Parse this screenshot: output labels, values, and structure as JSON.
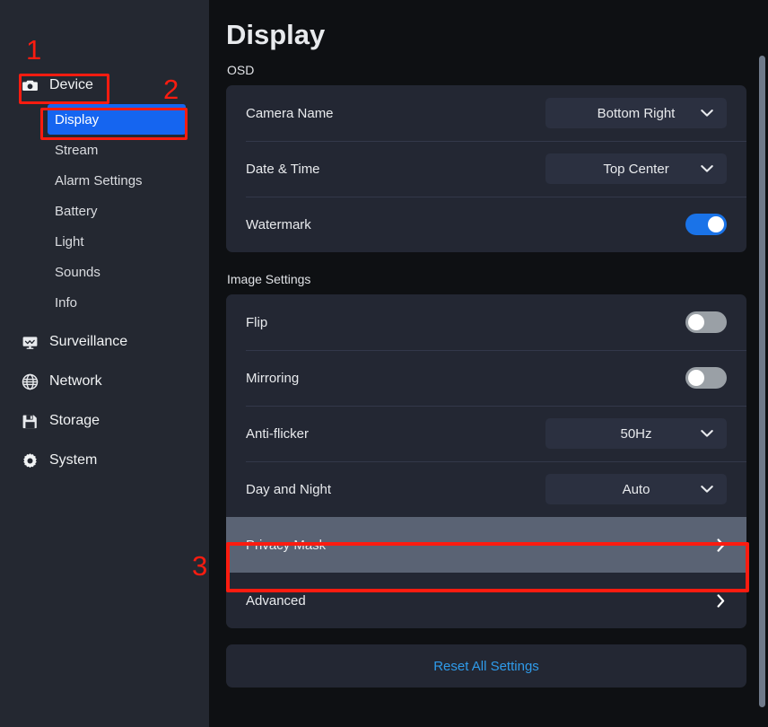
{
  "sidebar": {
    "groups": [
      {
        "id": "device",
        "label": "Device",
        "icon": "camera-icon",
        "children": [
          {
            "id": "display",
            "label": "Display",
            "active": true
          },
          {
            "id": "stream",
            "label": "Stream",
            "active": false
          },
          {
            "id": "alarm-settings",
            "label": "Alarm Settings",
            "active": false
          },
          {
            "id": "battery",
            "label": "Battery",
            "active": false
          },
          {
            "id": "light",
            "label": "Light",
            "active": false
          },
          {
            "id": "sounds",
            "label": "Sounds",
            "active": false
          },
          {
            "id": "info",
            "label": "Info",
            "active": false
          }
        ]
      },
      {
        "id": "surveillance",
        "label": "Surveillance",
        "icon": "monitor-icon",
        "children": []
      },
      {
        "id": "network",
        "label": "Network",
        "icon": "globe-icon",
        "children": []
      },
      {
        "id": "storage",
        "label": "Storage",
        "icon": "floppy-disk-icon",
        "children": []
      },
      {
        "id": "system",
        "label": "System",
        "icon": "gear-icon",
        "children": []
      }
    ]
  },
  "main": {
    "title": "Display",
    "sections": [
      {
        "label": "OSD",
        "rows": [
          {
            "label": "Camera Name",
            "control": "dropdown",
            "value": "Bottom Right"
          },
          {
            "label": "Date & Time",
            "control": "dropdown",
            "value": "Top Center"
          },
          {
            "label": "Watermark",
            "control": "toggle",
            "value": "on"
          }
        ]
      },
      {
        "label": "Image Settings",
        "rows": [
          {
            "label": "Flip",
            "control": "toggle",
            "value": "off"
          },
          {
            "label": "Mirroring",
            "control": "toggle",
            "value": "off"
          },
          {
            "label": "Anti-flicker",
            "control": "dropdown",
            "value": "50Hz"
          },
          {
            "label": "Day and Night",
            "control": "dropdown",
            "value": "Auto"
          },
          {
            "label": "Privacy Mask",
            "control": "chevron",
            "value": "",
            "highlighted": true
          },
          {
            "label": "Advanced",
            "control": "chevron",
            "value": ""
          }
        ]
      }
    ],
    "reset_button": "Reset All Settings"
  },
  "annotations": {
    "markers": [
      {
        "id": "1",
        "label": "1",
        "target": "Device"
      },
      {
        "id": "2",
        "label": "2",
        "target": "Display"
      },
      {
        "id": "3",
        "label": "3",
        "target": "Privacy Mask"
      }
    ],
    "color": "#fc1c10"
  },
  "colors": {
    "accent_blue": "#1565f0",
    "toggle_on": "#1a73e8",
    "toggle_off": "#9aa0a6",
    "link_blue": "#2f9bea",
    "sidebar_bg": "#242831",
    "main_bg": "#0e1013",
    "card_bg": "#232733",
    "highlight_row": "#5a6374",
    "annotation_red": "#fc1c10"
  }
}
